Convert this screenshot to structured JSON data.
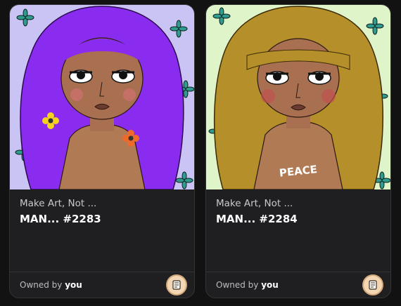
{
  "cards": [
    {
      "collection": "Make Art, Not ...",
      "token": "MAN... #2283",
      "owned_prefix": "Owned by",
      "owned_user": "you",
      "badge_icon": "scroll-icon",
      "colors": {
        "background": "#c9c4f3",
        "hair": "#8a2cf0"
      }
    },
    {
      "collection": "Make Art, Not ...",
      "token": "MAN... #2284",
      "owned_prefix": "Owned by",
      "owned_user": "you",
      "badge_icon": "scroll-icon",
      "colors": {
        "background": "#dff3c8",
        "hair": "#b58f2a"
      },
      "art_text": "PEACE"
    }
  ]
}
